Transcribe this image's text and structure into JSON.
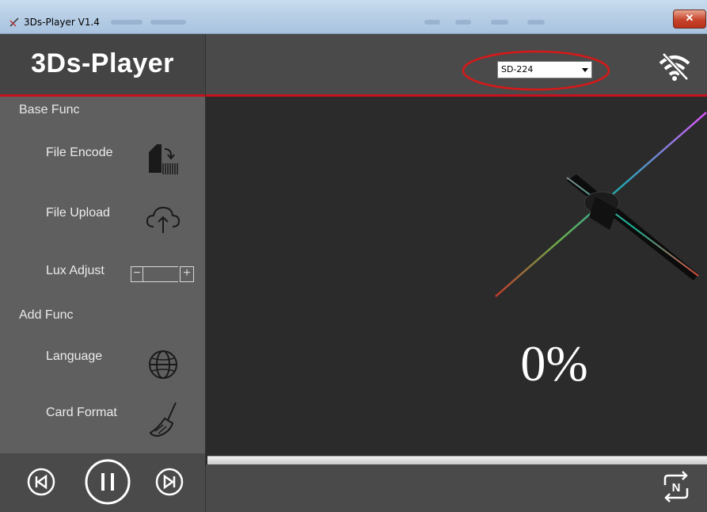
{
  "window": {
    "title": "3Ds-Player V1.4"
  },
  "sidebar": {
    "brand": "3Ds-Player",
    "sections": [
      {
        "label": "Base Func"
      },
      {
        "label": "Add Func"
      }
    ],
    "items": [
      {
        "label": "File Encode",
        "icon": "file-encode-icon"
      },
      {
        "label": "File Upload",
        "icon": "cloud-upload-icon"
      },
      {
        "label": "Lux Adjust",
        "icon": "lux-stepper"
      },
      {
        "label": "Language",
        "icon": "globe-icon"
      },
      {
        "label": "Card Format",
        "icon": "broom-icon"
      }
    ],
    "lux": {
      "minus": "−",
      "plus": "+"
    }
  },
  "topbar": {
    "device": {
      "selected": "SD-224"
    }
  },
  "main": {
    "progress_text": "0%",
    "progress": 0
  },
  "colors": {
    "accent": "#c8101e",
    "sidebar_bg": "#5f5f5f",
    "header_bg": "#444444",
    "main_bg": "#2b2b2b"
  }
}
